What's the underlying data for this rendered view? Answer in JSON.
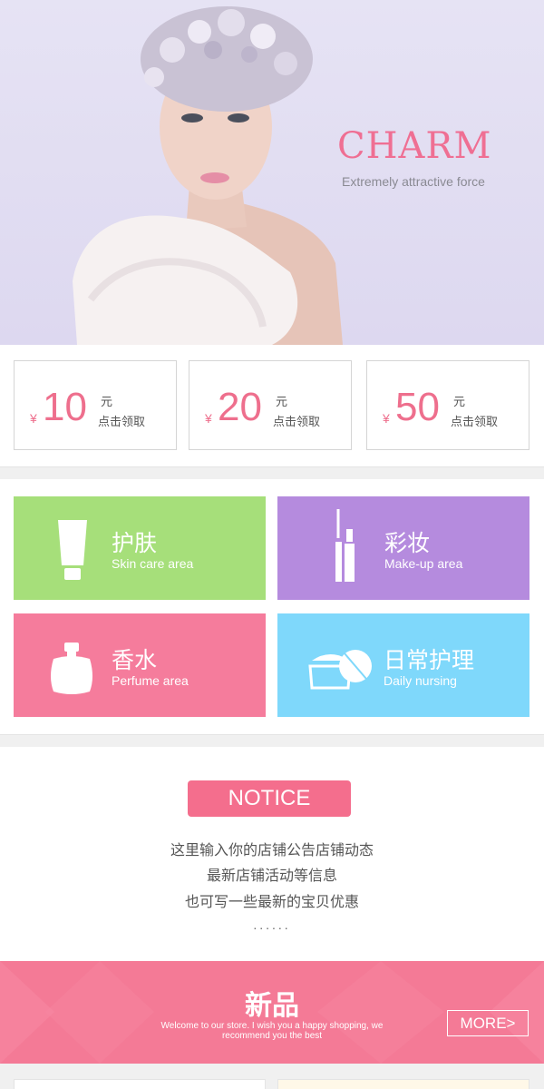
{
  "hero": {
    "title": "CHARM",
    "subtitle": "Extremely attractive force"
  },
  "coupons": [
    {
      "currency": "¥",
      "amount": "10",
      "unit": "元",
      "action": "点击领取"
    },
    {
      "currency": "¥",
      "amount": "20",
      "unit": "元",
      "action": "点击领取"
    },
    {
      "currency": "¥",
      "amount": "50",
      "unit": "元",
      "action": "点击领取"
    }
  ],
  "categories": [
    {
      "cn": "护肤",
      "en": "Skin care area",
      "color": "#a6df7a",
      "icon": "lotion-tube-icon"
    },
    {
      "cn": "彩妆",
      "en": "Make-up area",
      "color": "#b58bde",
      "icon": "mascara-icon"
    },
    {
      "cn": "香水",
      "en": "Perfume area",
      "color": "#f57c9c",
      "icon": "perfume-bottle-icon"
    },
    {
      "cn": "日常护理",
      "en": "Daily nursing",
      "color": "#7fd8fb",
      "icon": "cream-jar-icon"
    }
  ],
  "notice": {
    "button": "NOTICE",
    "lines": [
      "这里输入你的店铺公告店铺动态",
      "最新店铺活动等信息",
      "也可写一些最新的宝贝优惠"
    ],
    "dots": "......"
  },
  "banner": {
    "title": "新品",
    "welcome": "Welcome to our store. I wish you a happy shopping, we recommend you the best",
    "more": "MORE>"
  },
  "colors": {
    "accent": "#ef6f93",
    "notice": "#f46e8d",
    "banner": "#f47a96"
  }
}
